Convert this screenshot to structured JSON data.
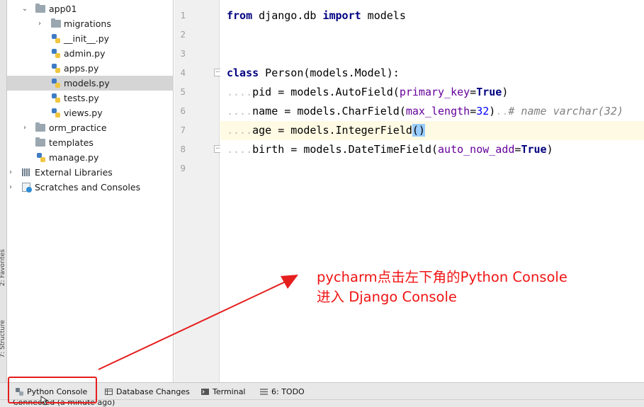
{
  "left_strip": {
    "tabs": [
      "2: Favorites",
      "7: Structure"
    ]
  },
  "project_tree": {
    "items": [
      {
        "label": "app01",
        "type": "folder",
        "expanded": true,
        "depth": 1
      },
      {
        "label": "migrations",
        "type": "folder",
        "expanded": false,
        "depth": 2
      },
      {
        "label": "__init__.py",
        "type": "python-file",
        "depth": 2
      },
      {
        "label": "admin.py",
        "type": "python-file",
        "depth": 2
      },
      {
        "label": "apps.py",
        "type": "python-file",
        "depth": 2
      },
      {
        "label": "models.py",
        "type": "python-file",
        "depth": 2,
        "selected": true
      },
      {
        "label": "tests.py",
        "type": "python-file",
        "depth": 2
      },
      {
        "label": "views.py",
        "type": "python-file",
        "depth": 2
      },
      {
        "label": "orm_practice",
        "type": "folder",
        "expanded": false,
        "depth": 1
      },
      {
        "label": "templates",
        "type": "folder",
        "depth": 1
      },
      {
        "label": "manage.py",
        "type": "python-file",
        "depth": 1
      },
      {
        "label": "External Libraries",
        "type": "library",
        "expanded": false,
        "depth": 0
      },
      {
        "label": "Scratches and Consoles",
        "type": "scratch",
        "expanded": false,
        "depth": 0
      }
    ]
  },
  "editor": {
    "line_numbers": [
      "1",
      "2",
      "3",
      "4",
      "5",
      "6",
      "7",
      "8",
      "9"
    ],
    "current_line": 7,
    "code": {
      "l1_from": "from",
      "l1_mod": " django.db ",
      "l1_import": "import",
      "l1_name": " models",
      "l4_class": "class",
      "l4_rest": " Person(models.Model):",
      "l5_dots": "....",
      "l5_a": "pid = models.AutoField(",
      "l5_param": "primary_key",
      "l5_eq": "=",
      "l5_true": "True",
      "l5_close": ")",
      "l6_dots": "....",
      "l6_a": "name = models.CharField(",
      "l6_param": "max_length",
      "l6_eq": "=",
      "l6_num": "32",
      "l6_close": ")",
      "l6_dots2": "..",
      "l6_comment": "# name varchar(32)",
      "l7_dots": "....",
      "l7_a": "age = models.IntegerField",
      "l7_paren": "()",
      "l8_dots": "....",
      "l8_a": "birth = models.DateTimeField(",
      "l8_param": "auto_now_add",
      "l8_eq": "=",
      "l8_true": "True",
      "l8_close": ")"
    }
  },
  "annotation": {
    "line1": "pycharm点击左下角的Python Console",
    "line2": "进入 Django Console",
    "color": "#f01414"
  },
  "bottom_tools": [
    {
      "label": "Python Console",
      "icon": "python-icon"
    },
    {
      "label": "Database Changes",
      "icon": "database-icon"
    },
    {
      "label": "Terminal",
      "icon": "terminal-icon"
    },
    {
      "label": "6: TODO",
      "icon": "todo-icon"
    }
  ],
  "status_bar": {
    "text": "Connected (a minute ago)"
  }
}
